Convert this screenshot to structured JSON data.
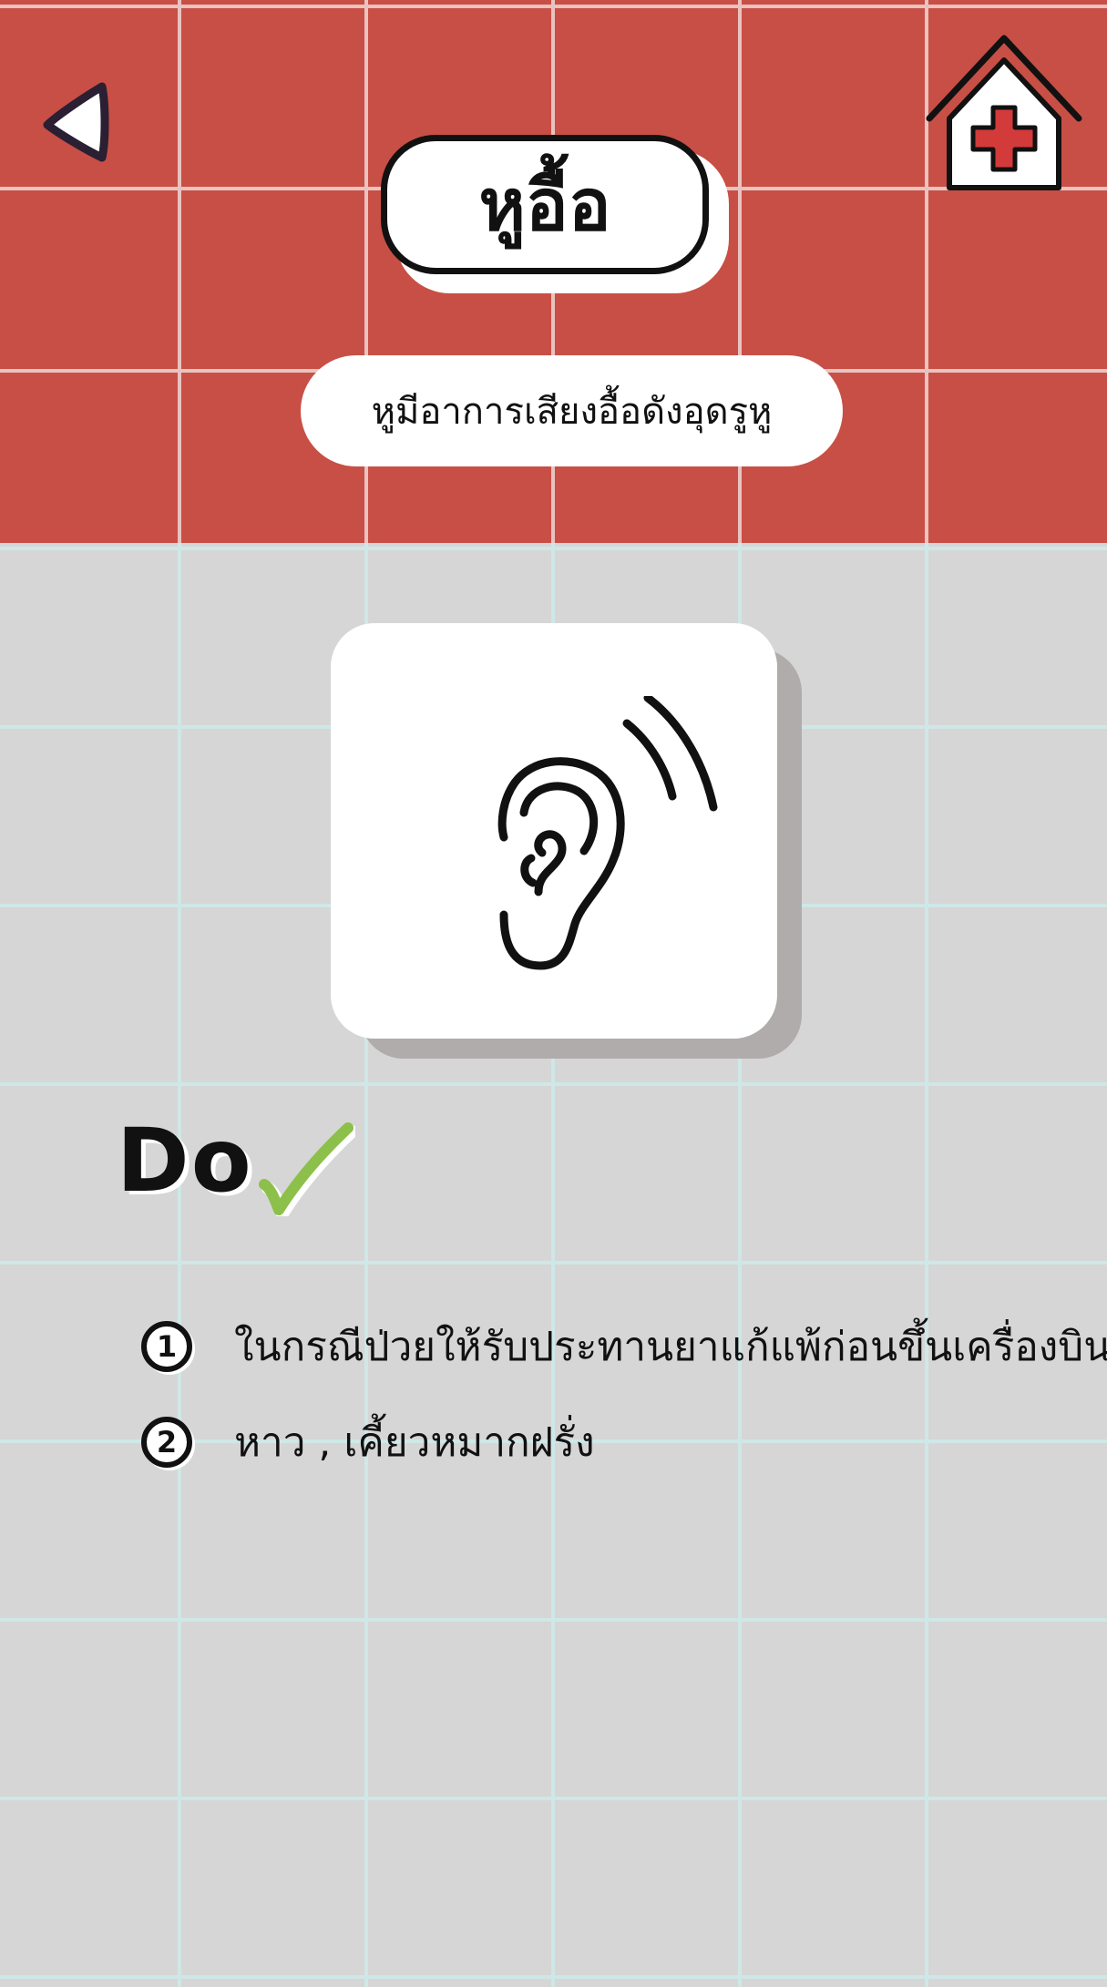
{
  "header": {
    "title": "หูอื้อ",
    "subtitle": "หูมีอาการเสียงอื้อดังอุดรูหู"
  },
  "nav": {
    "back_icon": "back-triangle-icon",
    "home_icon": "home-hospital-icon"
  },
  "illustration": {
    "icon": "ear-icon"
  },
  "do_section": {
    "label": "Do",
    "icon": "checkmark-icon",
    "items": [
      {
        "number": "1",
        "text": "ในกรณีป่วยให้รับประทานยาแก้แพ้ก่อนขึ้นเครื่องบิน"
      },
      {
        "number": "2",
        "text": "หาว , เคี้ยวหมากฝรั่ง"
      }
    ]
  },
  "colors": {
    "header_red": "#c84f45",
    "body_gray": "#d6d6d6",
    "cross_red": "#d33a3a",
    "check_green": "#8cc04b"
  }
}
